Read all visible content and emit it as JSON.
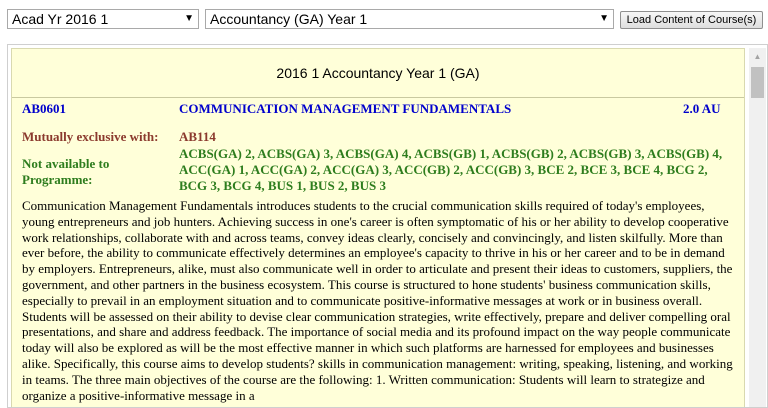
{
  "controls": {
    "year_select": "Acad Yr 2016 1",
    "programme_select": "Accountancy (GA) Year 1",
    "load_button": "Load Content of Course(s)"
  },
  "panel": {
    "title": "2016 1 Accountancy Year 1 (GA)",
    "course": {
      "code": "AB0601",
      "name": "COMMUNICATION MANAGEMENT FUNDAMENTALS",
      "au": "2.0 AU",
      "mutually_exclusive_label": "Mutually exclusive with:",
      "mutually_exclusive_value": "AB114",
      "not_available_label": "Not available to Programme:",
      "not_available_value": "ACBS(GA) 2, ACBS(GA) 3, ACBS(GA) 4, ACBS(GB) 1, ACBS(GB) 2, ACBS(GB) 3, ACBS(GB) 4, ACC(GA) 1, ACC(GA) 2, ACC(GA) 3, ACC(GB) 2, ACC(GB) 3, BCE 2, BCE 3, BCE 4, BCG 2, BCG 3, BCG 4, BUS 1, BUS 2, BUS 3",
      "description": "Communication Management Fundamentals introduces students to the crucial communication skills required of today's employees, young entrepreneurs and job hunters. Achieving success in one's career is often symptomatic of his or her ability to develop cooperative work relationships, collaborate with and across teams, convey ideas clearly, concisely and convincingly, and listen skilfully. More than ever before, the ability to communicate effectively determines an employee's capacity to thrive in his or her career and to be in demand by employers. Entrepreneurs, alike, must also communicate well in order to articulate and present their ideas to customers, suppliers, the government, and other partners in the business ecosystem. This course is structured to hone students' business communication skills, especially to prevail in an employment situation and to communicate positive-informative messages at work or in business overall. Students will be assessed on their ability to devise clear communication strategies, write effectively, prepare and deliver compelling oral presentations, and share and address feedback. The importance of social media and its profound impact on the way people communicate today will also be explored as will be the most effective manner in which such platforms are harnessed for employees and businesses alike. Specifically, this course aims to develop students? skills in communication management: writing, speaking, listening, and working in teams. The three main objectives of the course are the following: 1. Written communication: Students will learn to strategize and organize a positive-informative message in a"
    }
  },
  "icons": {
    "dropdown": "chevron-down-icon",
    "scroll_up": "scroll-up-arrow-icon"
  },
  "colors": {
    "panel_bg": "#ffffd9",
    "course_blue": "#0000cc",
    "exclusive_red": "#8b3a2e",
    "programme_green": "#2e7d1e"
  }
}
